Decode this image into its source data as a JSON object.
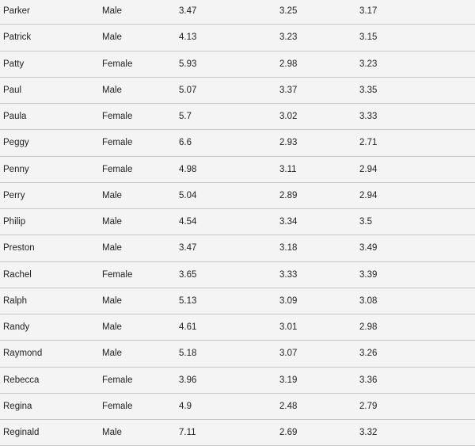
{
  "table": {
    "rows": [
      [
        "Parker",
        "Male",
        "3.47",
        "3.25",
        "3.17"
      ],
      [
        "Patrick",
        "Male",
        "4.13",
        "3.23",
        "3.15"
      ],
      [
        "Patty",
        "Female",
        "5.93",
        "2.98",
        "3.23"
      ],
      [
        "Paul",
        "Male",
        "5.07",
        "3.37",
        "3.35"
      ],
      [
        "Paula",
        "Female",
        "5.7",
        "3.02",
        "3.33"
      ],
      [
        "Peggy",
        "Female",
        "6.6",
        "2.93",
        "2.71"
      ],
      [
        "Penny",
        "Female",
        "4.98",
        "3.11",
        "2.94"
      ],
      [
        "Perry",
        "Male",
        "5.04",
        "2.89",
        "2.94"
      ],
      [
        "Philip",
        "Male",
        "4.54",
        "3.34",
        "3.5"
      ],
      [
        "Preston",
        "Male",
        "3.47",
        "3.18",
        "3.49"
      ],
      [
        "Rachel",
        "Female",
        "3.65",
        "3.33",
        "3.39"
      ],
      [
        "Ralph",
        "Male",
        "5.13",
        "3.09",
        "3.08"
      ],
      [
        "Randy",
        "Male",
        "4.61",
        "3.01",
        "2.98"
      ],
      [
        "Raymond",
        "Male",
        "5.18",
        "3.07",
        "3.26"
      ],
      [
        "Rebecca",
        "Female",
        "3.96",
        "3.19",
        "3.36"
      ],
      [
        "Regina",
        "Female",
        "4.9",
        "2.48",
        "2.79"
      ],
      [
        "Reginald",
        "Male",
        "7.11",
        "2.69",
        "3.32"
      ]
    ]
  }
}
